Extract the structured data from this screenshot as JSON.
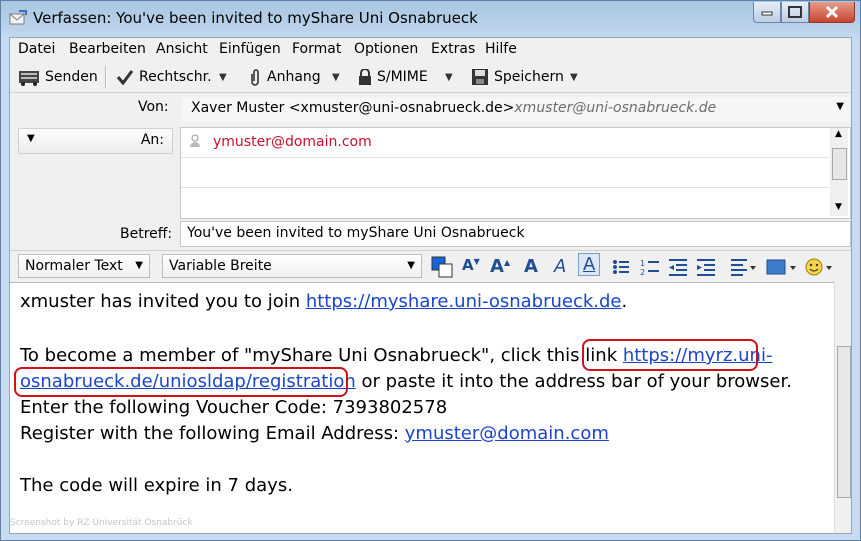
{
  "window": {
    "title": "Verfassen: You've been invited to myShare Uni Osnabrueck",
    "buttons": [
      "minimize",
      "maximize",
      "close"
    ]
  },
  "menubar": {
    "items": [
      "Datei",
      "Bearbeiten",
      "Ansicht",
      "Einfügen",
      "Format",
      "Optionen",
      "Extras",
      "Hilfe"
    ]
  },
  "toolbar": {
    "send": "Senden",
    "spelling": "Rechtschr.",
    "attach": "Anhang",
    "smime": "S/MIME",
    "save": "Speichern"
  },
  "header": {
    "from_label": "Von:",
    "from_value": "Xaver Muster <xmuster@uni-osnabrueck.de>",
    "from_alias": "xmuster@uni-osnabrueck.de",
    "to_label": "An:",
    "to_value": "ymuster@domain.com",
    "subject_label": "Betreff:",
    "subject_value": "You've been invited to myShare Uni Osnabrueck"
  },
  "format_toolbar": {
    "paragraph_style": "Normaler Text",
    "font": "Variable Breite"
  },
  "body": {
    "line1_text": "xmuster has invited you to join ",
    "line1_link": "https://myshare.uni-osnabrueck.de",
    "line1_end": ".",
    "line2_text": "To become a member of \"myShare Uni Osnabrueck\", click this link ",
    "line2_link": "https://myrz.uni-",
    "line3_link": "osnabrueck.de/uniosldap/registration",
    "line3_text": " or paste it into the address bar of your browser.",
    "line4": "Enter the following Voucher Code: 7393802578",
    "line5_text": "Register with the following Email Address: ",
    "line5_link": "ymuster@domain.com",
    "line6": "The code will expire in 7 days."
  },
  "watermark": "Screenshot by RZ Universität Osnabrück",
  "colors": {
    "link": "#1a45c9",
    "highlight_circle": "#d0101a",
    "recipient": "#c8102e"
  }
}
